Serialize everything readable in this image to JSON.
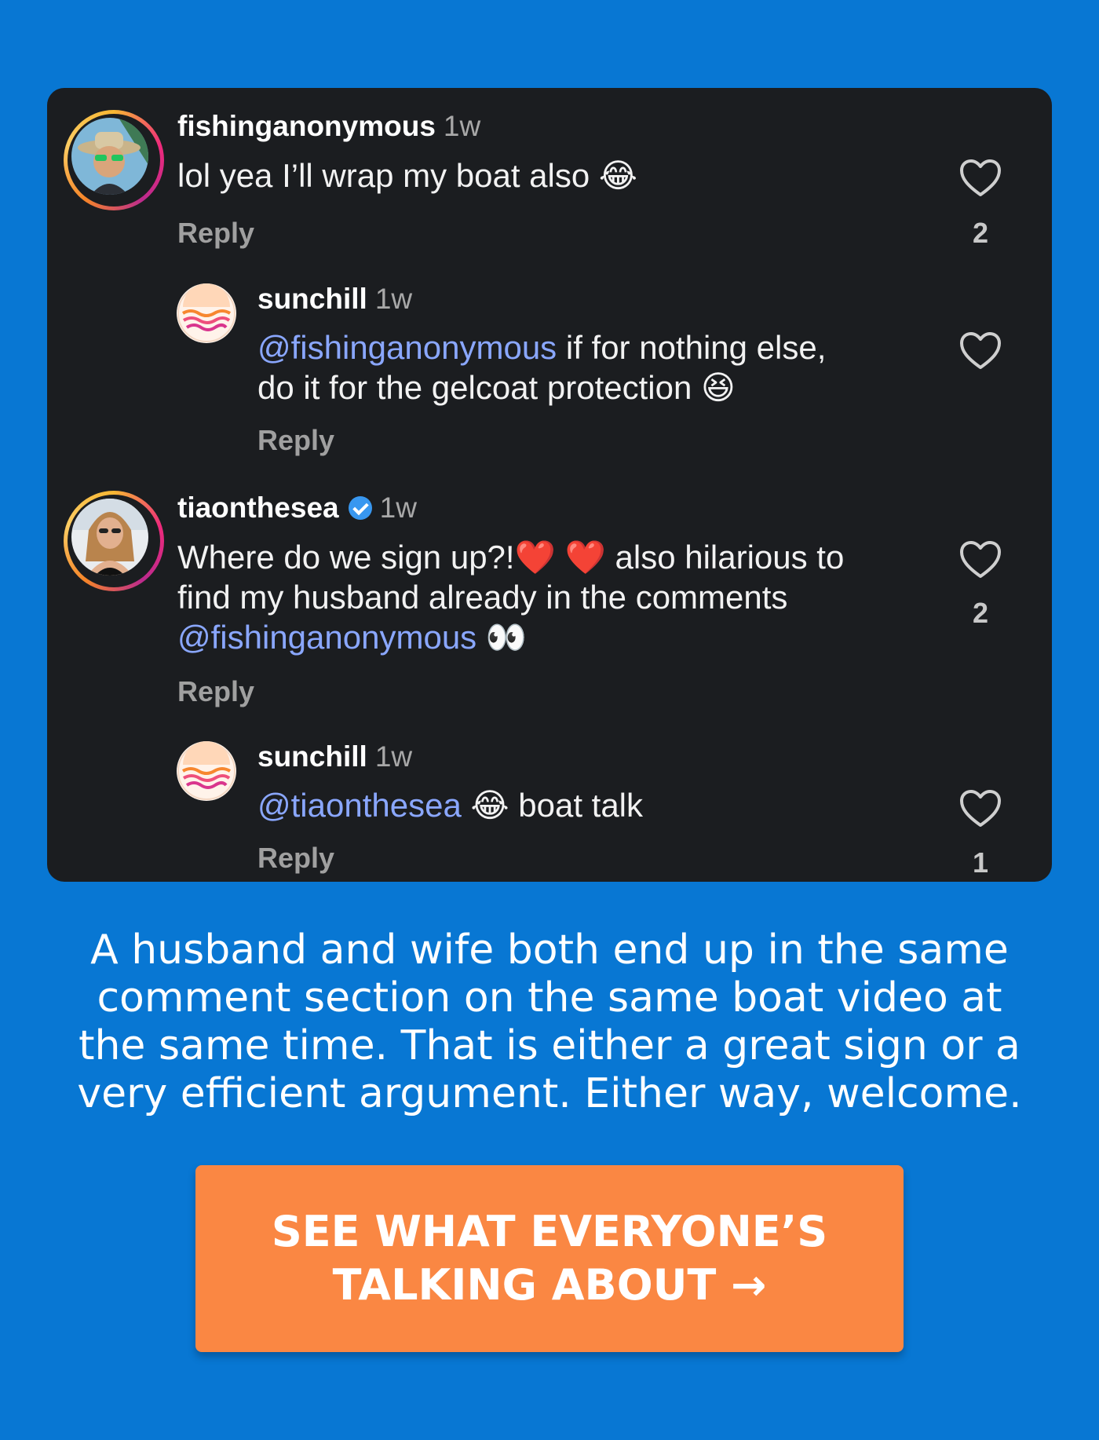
{
  "comments": [
    {
      "username": "fishinganonymous",
      "time": "1w",
      "text": "lol yea I’ll wrap my boat also 😂",
      "reply_label": "Reply",
      "likes": "2"
    },
    {
      "username": "sunchill",
      "time": "1w",
      "mention": "@fishinganonymous",
      "line1": " if for nothing else,",
      "line2": "do it for the gelcoat protection 😆",
      "reply_label": "Reply"
    },
    {
      "username": "tiaonthesea",
      "time": "1w",
      "line1": "Where do we sign up?!❤️ ❤️ also hilarious to",
      "line2": "find my husband already in the comments",
      "mention": "@fishinganonymous",
      "line3_suffix": " 👀",
      "reply_label": "Reply",
      "likes": "2"
    },
    {
      "username": "sunchill",
      "time": "1w",
      "mention": "@tiaonthesea",
      "text": " 😂 boat talk",
      "reply_label": "Reply",
      "likes": "1"
    }
  ],
  "caption": "A husband and wife both end up in the same comment section on the same boat video at the same time. That is either a great sign or a very efficient argument. Either way, welcome.",
  "cta": {
    "label": "SEE WHAT EVERYONE’S TALKING ABOUT →"
  },
  "colors": {
    "background": "#0877d3",
    "card": "#1b1d20",
    "mention": "#8aa7ff",
    "cta": "#fa8743"
  }
}
